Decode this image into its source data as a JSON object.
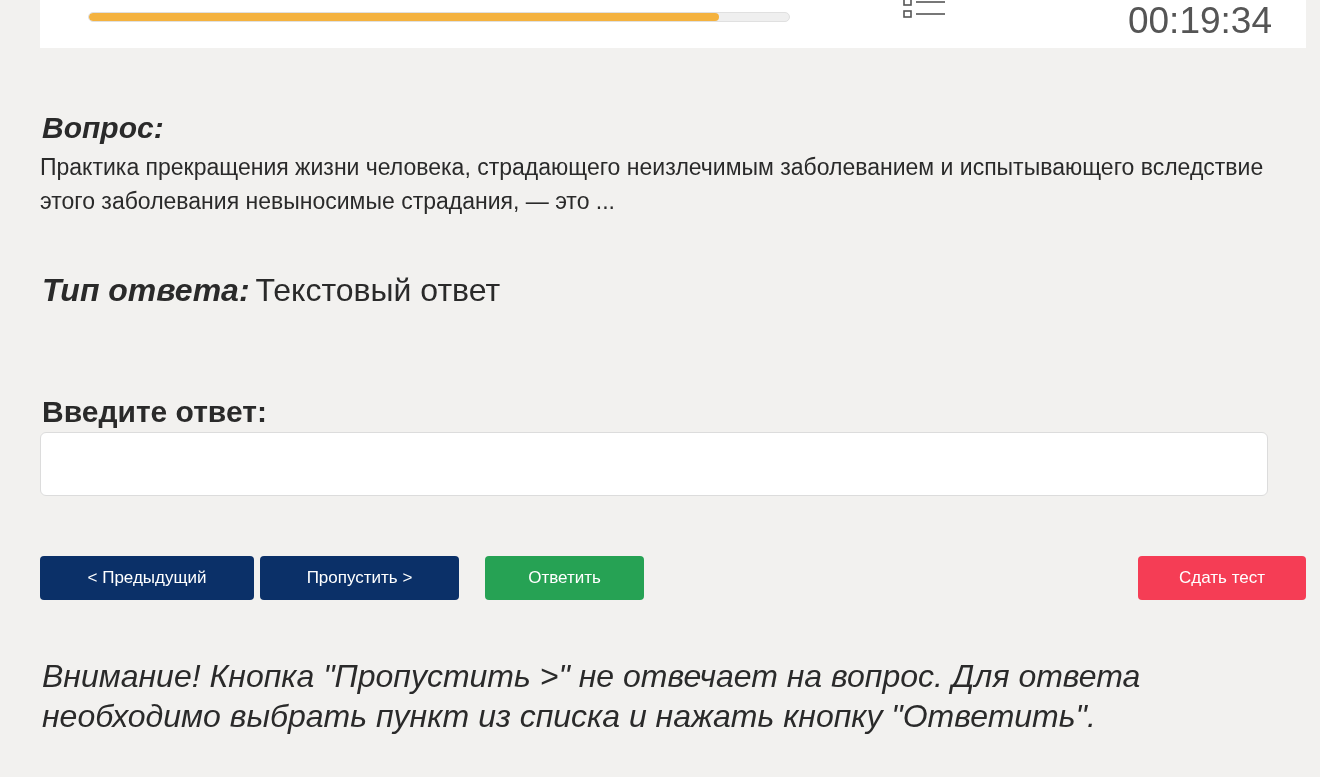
{
  "progress": {
    "level": 0.9
  },
  "timer": "00:19:34",
  "question": {
    "heading": "Вопрос:",
    "text": "Практика прекращения жизни человека, страдающего неизлечимым заболеванием и испытывающего вследствие этого заболевания невыносимые страдания, — это ..."
  },
  "answer_type": {
    "label": "Тип ответа:",
    "value": "Текстовый ответ"
  },
  "answer": {
    "label": "Введите ответ:"
  },
  "buttons": [
    {
      "label": "< Предыдущий",
      "kind": "secondary"
    },
    {
      "label": "Пропустить >",
      "kind": "secondary"
    },
    {
      "label": "Ответить",
      "kind": "primary"
    },
    {
      "label": "Сдать тест",
      "kind": "danger"
    }
  ],
  "warning": "Внимание! Кнопка \"Пропустить >\" не отвечает на вопрос. Для ответа необходимо выбрать пункт из списка и нажать кнопку \"Ответить\"."
}
